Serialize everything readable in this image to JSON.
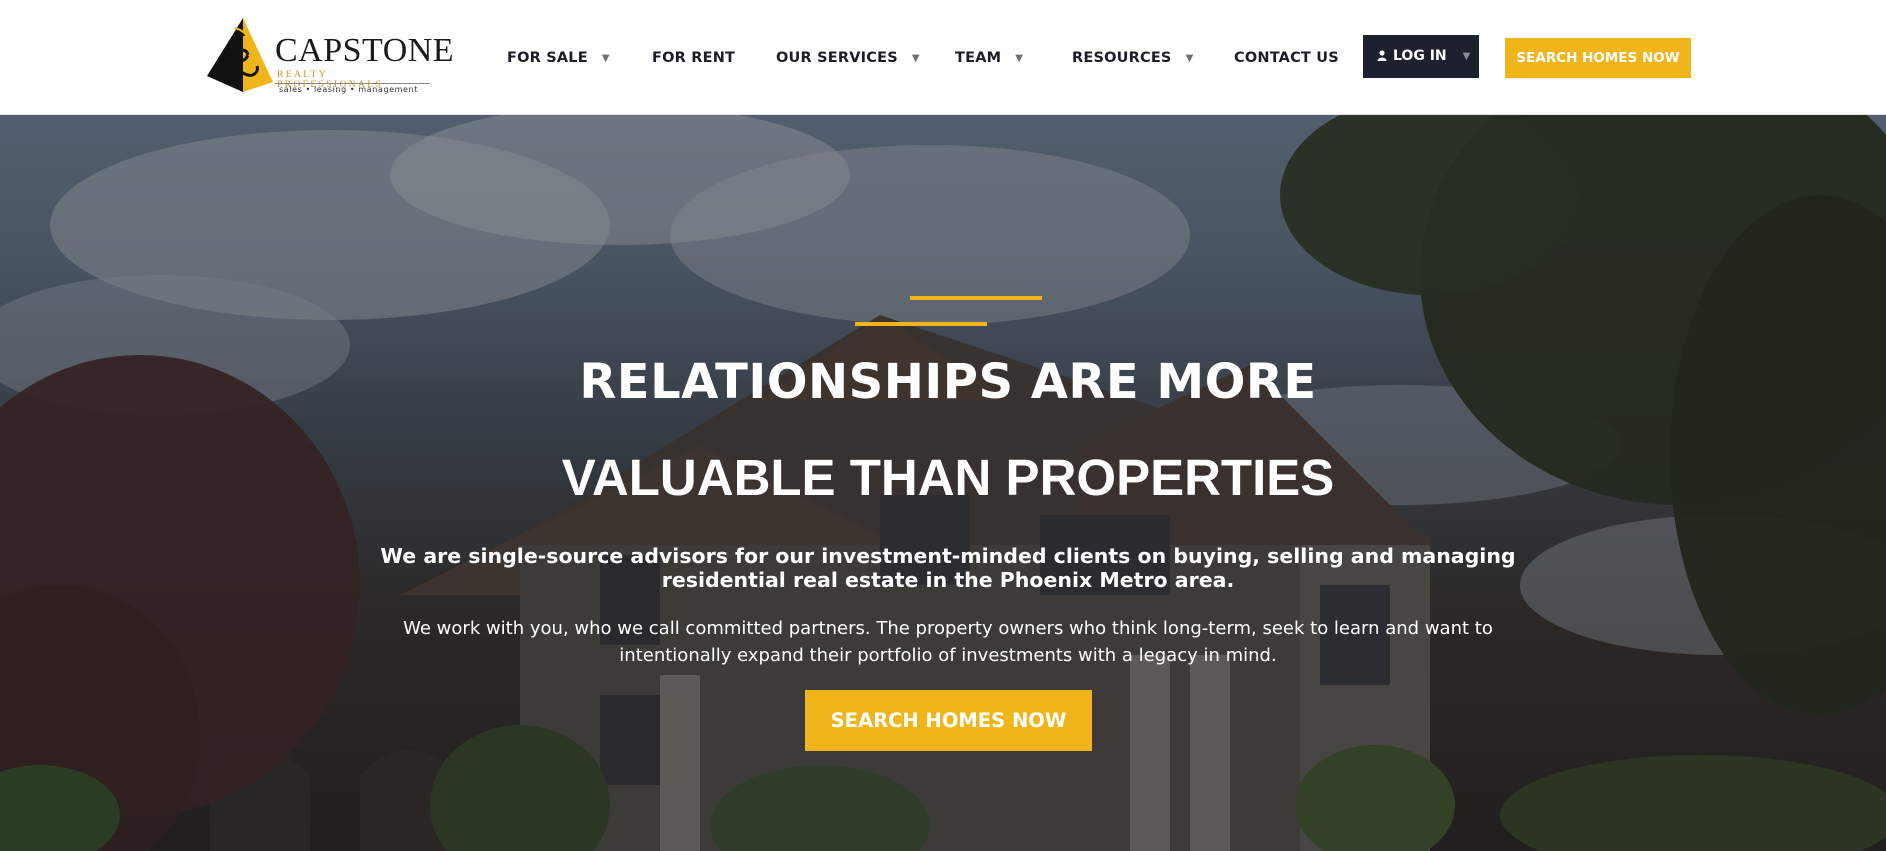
{
  "brand": {
    "name": "CAPSTONE",
    "subtitle": "REALTY PROFESSIONALS",
    "tagline": "sales  •  leasing  •  management",
    "logo_icon": "capstone-pyramid-logo",
    "colors": {
      "accent": "#f0b51b",
      "dark": "#1d202d"
    }
  },
  "nav": {
    "items": [
      {
        "label": "FOR SALE",
        "has_dropdown": true
      },
      {
        "label": "FOR RENT",
        "has_dropdown": false
      },
      {
        "label": "OUR SERVICES",
        "has_dropdown": true
      },
      {
        "label": "TEAM",
        "has_dropdown": true
      },
      {
        "label": "RESOURCES",
        "has_dropdown": true
      },
      {
        "label": "CONTACT US",
        "has_dropdown": false
      }
    ],
    "dropdown_icon": "▼",
    "login": {
      "label": "LOG IN",
      "icon": "user-icon"
    },
    "search_button": "SEARCH HOMES NOW"
  },
  "hero": {
    "title_line1": "RELATIONSHIPS ARE MORE",
    "title_line2": "VALUABLE THAN PROPERTIES",
    "lead": "We are single-source advisors for our investment-minded clients on buying, selling and managing residential real estate in the Phoenix Metro area.",
    "body": "We work with you, who we call committed partners. The property owners who think long-term, seek to learn and want to intentionally expand their portfolio of investments with a legacy in mind.",
    "cta": "SEARCH HOMES NOW",
    "background": "house-under-cloudy-sky-photo"
  }
}
